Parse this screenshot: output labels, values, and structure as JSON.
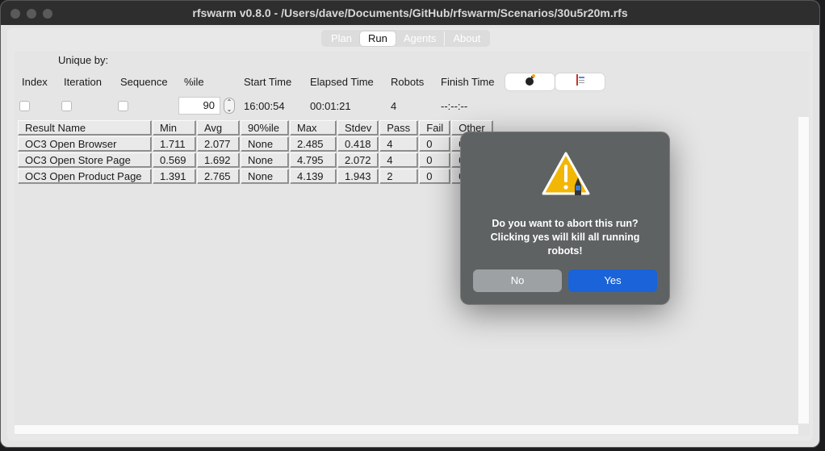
{
  "window": {
    "title": "rfswarm v0.8.0 - /Users/dave/Documents/GitHub/rfswarm/Scenarios/30u5r20m.rfs"
  },
  "tabs": [
    {
      "label": "Plan"
    },
    {
      "label": "Run",
      "active": true
    },
    {
      "label": "Agents"
    },
    {
      "label": "About"
    }
  ],
  "controls": {
    "unique_by": "Unique by:",
    "index": "Index",
    "iteration": "Iteration",
    "sequence": "Sequence",
    "percentile_label": "%ile",
    "percentile_value": "90",
    "start_time_label": "Start Time",
    "start_time": "16:00:54",
    "elapsed_label": "Elapsed Time",
    "elapsed": "00:01:21",
    "robots_label": "Robots",
    "robots": "4",
    "finish_label": "Finish Time",
    "finish": "--:--:--",
    "abort_icon": "bomb-icon",
    "report_icon": "report-icon"
  },
  "table": {
    "headers": [
      "Result Name",
      "Min",
      "Avg",
      "90%ile",
      "Max",
      "Stdev",
      "Pass",
      "Fail",
      "Other"
    ],
    "rows": [
      [
        "OC3 Open Browser",
        "1.711",
        "2.077",
        "None",
        "2.485",
        "0.418",
        "4",
        "0",
        "0"
      ],
      [
        "OC3 Open Store Page",
        "0.569",
        "1.692",
        "None",
        "4.795",
        "2.072",
        "4",
        "0",
        "0"
      ],
      [
        "OC3 Open Product Page",
        "1.391",
        "2.765",
        "None",
        "4.139",
        "1.943",
        "2",
        "0",
        "0"
      ]
    ]
  },
  "dialog": {
    "icon": "warning-icon",
    "line1": "Do you want to abort this run?",
    "line2": "Clicking yes will kill all running",
    "line3": "robots!",
    "no": "No",
    "yes": "Yes",
    "yes_color": "#1a63d9",
    "no_color": "#9ea1a3"
  }
}
